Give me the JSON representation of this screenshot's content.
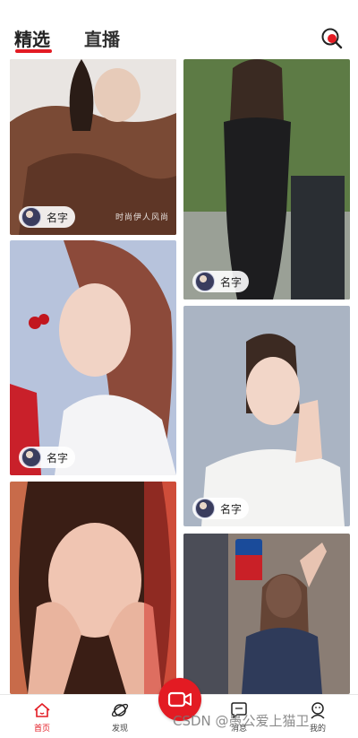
{
  "header": {
    "tabs": [
      {
        "label": "精选",
        "active": true
      },
      {
        "label": "直播",
        "active": false
      }
    ],
    "search_icon": "search-icon",
    "accent_color": "#e31b23"
  },
  "feed": {
    "cards": [
      {
        "author": "名字",
        "watermark": "时尚伊人风尚"
      },
      {
        "author": "名字"
      },
      {
        "author": "名字"
      },
      {
        "author": "名字"
      },
      {
        "author": ""
      },
      {
        "author": ""
      }
    ]
  },
  "bottom_nav": {
    "items": [
      {
        "label": "首页",
        "icon": "home-icon",
        "active": true
      },
      {
        "label": "发现",
        "icon": "planet-icon",
        "active": false
      },
      {
        "label": "消息",
        "icon": "message-icon",
        "active": false
      },
      {
        "label": "我的",
        "icon": "profile-icon",
        "active": false
      }
    ],
    "record_icon": "video-camera-icon"
  },
  "overlay_watermark": "CSDN @愚公爱上猫卫"
}
